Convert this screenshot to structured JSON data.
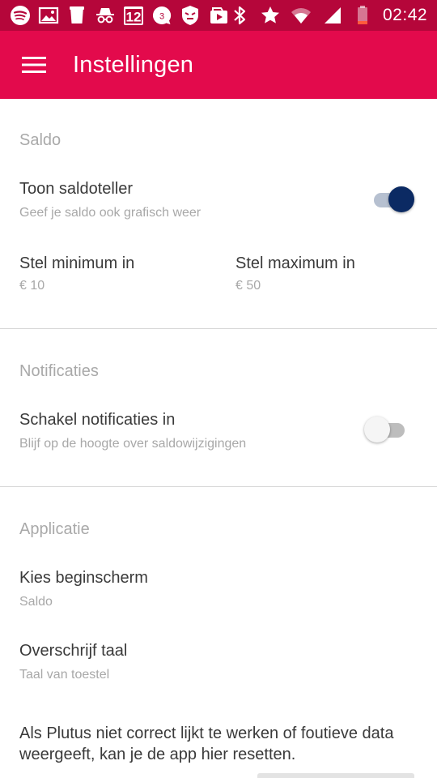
{
  "status_bar": {
    "left_icons": [
      "spotify-icon",
      "image-icon",
      "cup-icon",
      "incognito-icon",
      "calendar-icon",
      "chat-bubble-icon",
      "shield-face-icon",
      "photos-icon"
    ],
    "calendar_day": "12",
    "chat_count": "3",
    "right_icons": [
      "bluetooth-icon",
      "star-icon",
      "wifi-icon",
      "cell-signal-icon",
      "battery-icon"
    ],
    "time": "02:42"
  },
  "app_bar": {
    "title": "Instellingen",
    "background": "#e30a4c"
  },
  "sections": {
    "saldo": {
      "header": "Saldo",
      "toggle_title": "Toon saldoteller",
      "toggle_subtitle": "Geef je saldo ook grafisch weer",
      "toggle_on": true,
      "minimum_title": "Stel minimum in",
      "minimum_value": "€ 10",
      "maximum_title": "Stel maximum in",
      "maximum_value": "€ 50"
    },
    "notificaties": {
      "header": "Notificaties",
      "toggle_title": "Schakel notificaties in",
      "toggle_subtitle": "Blijf op de hoogte over saldowijzigingen",
      "toggle_on": false
    },
    "applicatie": {
      "header": "Applicatie",
      "start_title": "Kies beginscherm",
      "start_value": "Saldo",
      "lang_title": "Overschrijf taal",
      "lang_value": "Taal van toestel",
      "reset_text": "Als Plutus niet correct lijkt te werken of foutieve data weergeeft, kan je de app hier resetten."
    }
  },
  "colors": {
    "status_bar": "#b5063a",
    "toggle_on_thumb": "#0b2a63",
    "toggle_on_track": "#b6c0d0",
    "toggle_off_thumb": "#f5f5f5",
    "toggle_off_track": "#bdbdbd"
  }
}
